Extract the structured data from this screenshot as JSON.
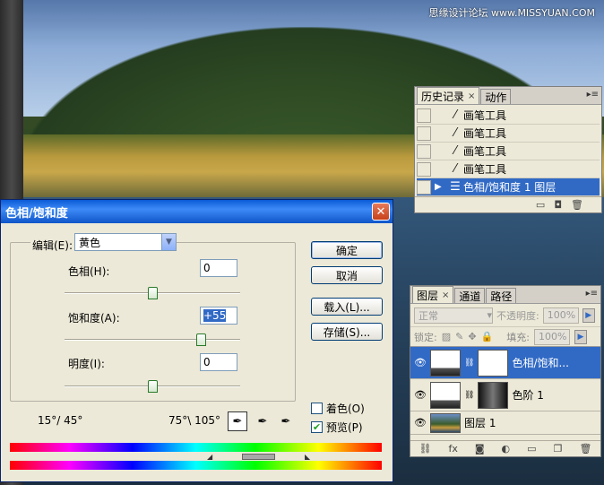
{
  "watermark": "思缘设计论坛 www.MISSYUAN.COM",
  "history": {
    "tabs": [
      {
        "label": "历史记录",
        "close": "×"
      },
      {
        "label": "动作"
      }
    ],
    "menu_icon": "panel-menu-icon",
    "items": [
      {
        "label": "画笔工具",
        "icon": "brush-icon",
        "selected": false
      },
      {
        "label": "画笔工具",
        "icon": "brush-icon",
        "selected": false
      },
      {
        "label": "画笔工具",
        "icon": "brush-icon",
        "selected": false
      },
      {
        "label": "画笔工具",
        "icon": "brush-icon",
        "selected": false
      },
      {
        "label": "色相/饱和度 1 图层",
        "icon": "adjustment-icon",
        "selected": true
      }
    ],
    "footer_icons": [
      "new-document-icon",
      "snapshot-icon",
      "trash-icon"
    ]
  },
  "layers": {
    "tabs": [
      {
        "label": "图层",
        "close": "×"
      },
      {
        "label": "通道"
      },
      {
        "label": "路径"
      }
    ],
    "blend_mode": "正常",
    "opacity_label": "不透明度:",
    "opacity_value": "100%",
    "lock_label": "锁定:",
    "fill_label": "填充:",
    "fill_value": "100%",
    "rows": [
      {
        "label": "色相/饱和...",
        "selected": true
      },
      {
        "label": "色阶 1",
        "selected": false
      },
      {
        "label": "图层 1",
        "selected": false
      }
    ],
    "footer_icons": [
      "link-icon",
      "fx-icon",
      "mask-icon",
      "adjustment-icon",
      "group-icon",
      "new-layer-icon",
      "trash-icon"
    ]
  },
  "dialog": {
    "title": "色相/饱和度",
    "edit_label": "编辑(E):",
    "edit_value": "黄色",
    "hue_label": "色相(H):",
    "hue_value": "0",
    "saturation_label": "饱和度(A):",
    "saturation_value": "+55",
    "lightness_label": "明度(I):",
    "lightness_value": "0",
    "ok": "确定",
    "cancel": "取消",
    "load": "载入(L)...",
    "save": "存储(S)...",
    "colorize_label": "着色(O)",
    "colorize_checked": false,
    "preview_label": "预览(P)",
    "preview_checked": true,
    "range_left": "15°/ 45°",
    "range_right": "75°\\ 105°",
    "slider_levels": {
      "hue": 0,
      "saturation": 55,
      "lightness": 0
    }
  }
}
